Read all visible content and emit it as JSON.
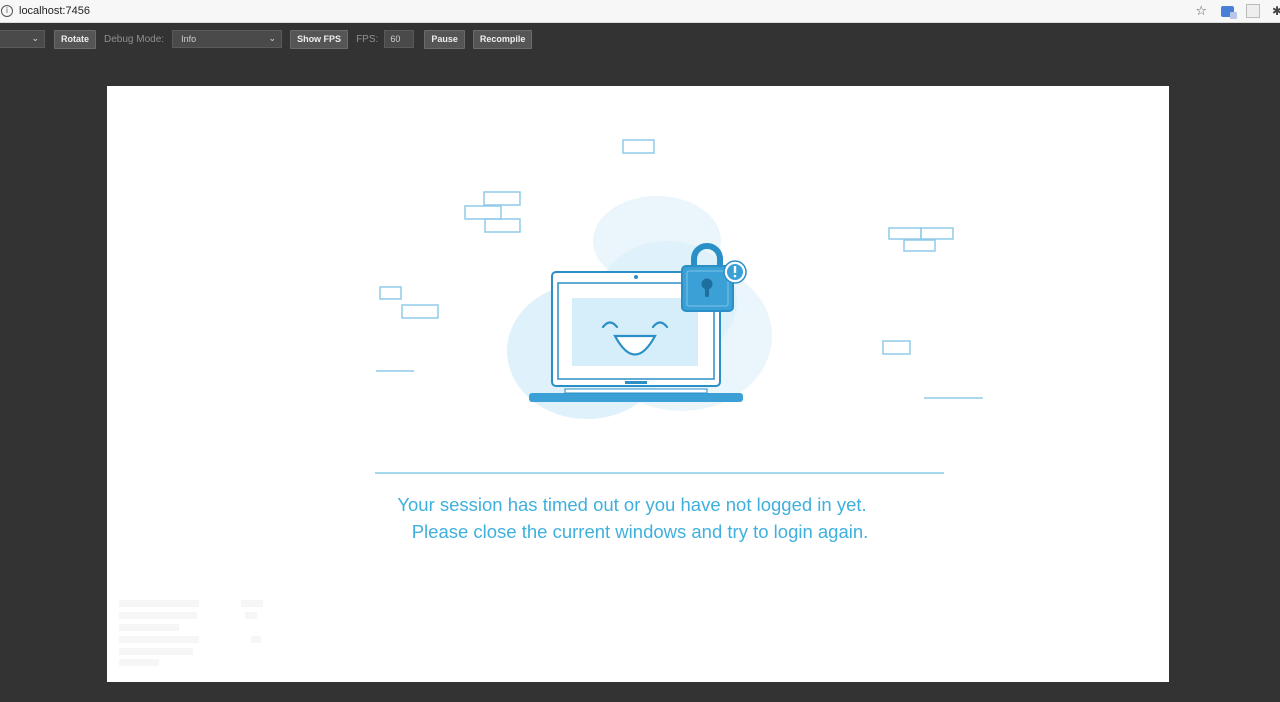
{
  "browser": {
    "url": "localhost:7456",
    "icons": [
      "info-icon",
      "star-icon",
      "translate-icon",
      "extension-icon",
      "puzzle-icon"
    ]
  },
  "toolbar": {
    "first_select_value": "",
    "rotate_label": "Rotate",
    "debug_mode_label": "Debug Mode:",
    "debug_mode_value": "Info",
    "show_fps_label": "Show FPS",
    "fps_label": "FPS:",
    "fps_value": "60",
    "pause_label": "Pause",
    "recompile_label": "Recompile"
  },
  "content": {
    "illustration": "laptop-with-lock",
    "message_line1": "Your session has timed out or you have not logged in yet.",
    "message_line2": "Please close the current windows and try to login again."
  },
  "colors": {
    "page_background": "#333333",
    "canvas_background": "#ffffff",
    "accent": "#3fb0de",
    "accent_dark": "#2a8fc6",
    "light_blue": "#d6eef9"
  }
}
